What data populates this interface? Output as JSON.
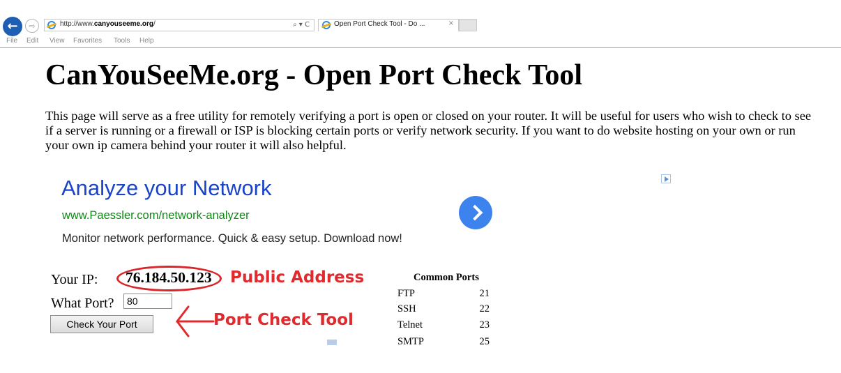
{
  "browser": {
    "url_prefix": "http://www.",
    "url_domain": "canyouseeme.org",
    "url_suffix": "/",
    "address_tools": "⌕ ▾ C",
    "tab_title": "Open Port Check Tool - Do ...",
    "tab_close": "×",
    "menu": [
      "File",
      "Edit",
      "View",
      "Favorites",
      "Tools",
      "Help"
    ]
  },
  "page": {
    "title": "CanYouSeeMe.org - Open Port Check Tool",
    "intro": "This page will serve as a free utility for remotely verifying a port is open or closed on your router. It will be useful for users who wish to check to see if a server is running or a firewall or ISP is blocking certain ports or verify network security. If you want to do website hosting on your own or run your own ip camera behind your router it will also helpful."
  },
  "ad": {
    "headline": "Analyze your Network",
    "url": "www.Paessler.com/network-analyzer",
    "description": "Monitor network performance. Quick & easy setup. Download now!"
  },
  "tool": {
    "your_ip_label": "Your IP:",
    "ip": "76.184.50.123",
    "port_label": "What Port?",
    "port_value": "80",
    "button_label": "Check Your Port"
  },
  "annotations": {
    "public_address": "Public Address",
    "port_check_tool": "Port Check Tool",
    "color": "#e02a2e"
  },
  "ports": {
    "title": "Common Ports",
    "rows": [
      {
        "name": "FTP",
        "port": "21"
      },
      {
        "name": "SSH",
        "port": "22"
      },
      {
        "name": "Telnet",
        "port": "23"
      },
      {
        "name": "SMTP",
        "port": "25"
      }
    ]
  }
}
